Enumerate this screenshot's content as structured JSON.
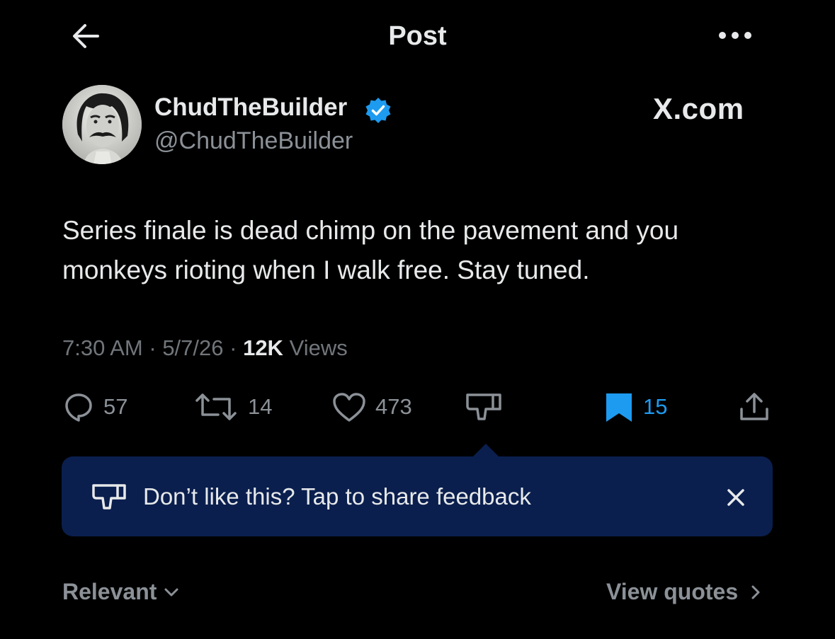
{
  "header": {
    "title": "Post",
    "back_icon": "arrow-left-icon",
    "more_icon": "more-horizontal-icon"
  },
  "author": {
    "name": "ChudTheBuilder",
    "handle": "@ChudTheBuilder",
    "verified": true,
    "verified_color": "#1d9bf0"
  },
  "watermark": "X.com",
  "post": {
    "text": "Series finale is dead chimp on the pavement and you monkeys rioting when I walk free. Stay tuned."
  },
  "meta": {
    "time": "7:30 AM",
    "date": "5/7/26",
    "views_count": "12K",
    "views_label": "Views"
  },
  "actions": {
    "replies": "57",
    "reposts": "14",
    "likes": "473",
    "bookmarks": "15"
  },
  "feedback": {
    "text": "Don’t like this? Tap to share feedback",
    "background": "#0a1f4e"
  },
  "footer": {
    "sort_label": "Relevant",
    "view_quotes_label": "View quotes"
  },
  "colors": {
    "background": "#000000",
    "primary_text": "#e7e9ea",
    "secondary_text": "#8b9197",
    "accent": "#1d9bf0"
  }
}
